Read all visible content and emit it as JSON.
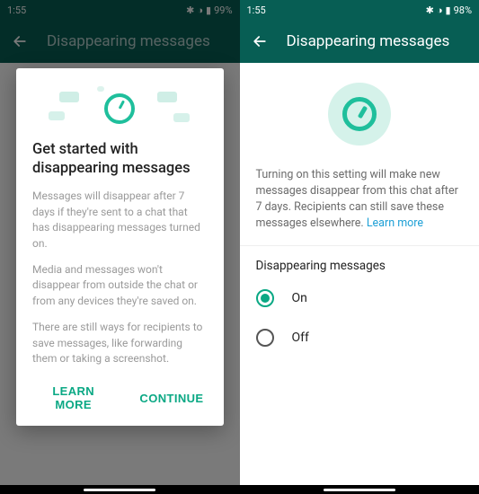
{
  "left": {
    "status": {
      "time": "1:55",
      "battery": "99%"
    },
    "app_bar": {
      "title": "Disappearing messages"
    },
    "modal": {
      "heading": "Get started with disappearing messages",
      "p1": "Messages will disappear after 7 days if they're sent to a chat that has disappearing messages turned on.",
      "p2": "Media and messages won't disappear from outside the chat or from any devices they're saved on.",
      "p3": "There are still ways for recipients to save messages, like forwarding them or taking a screenshot.",
      "learn_more": "LEARN MORE",
      "continue": "CONTINUE"
    }
  },
  "right": {
    "status": {
      "time": "1:55",
      "battery": "98%"
    },
    "app_bar": {
      "title": "Disappearing messages"
    },
    "description_text": "Turning on this setting will make new messages disappear from this chat after 7 days. Recipients can still save these messages elsewhere.",
    "learn_more": "Learn more",
    "section_title": "Disappearing messages",
    "options": {
      "on": "On",
      "off": "Off"
    },
    "selected": "on"
  }
}
